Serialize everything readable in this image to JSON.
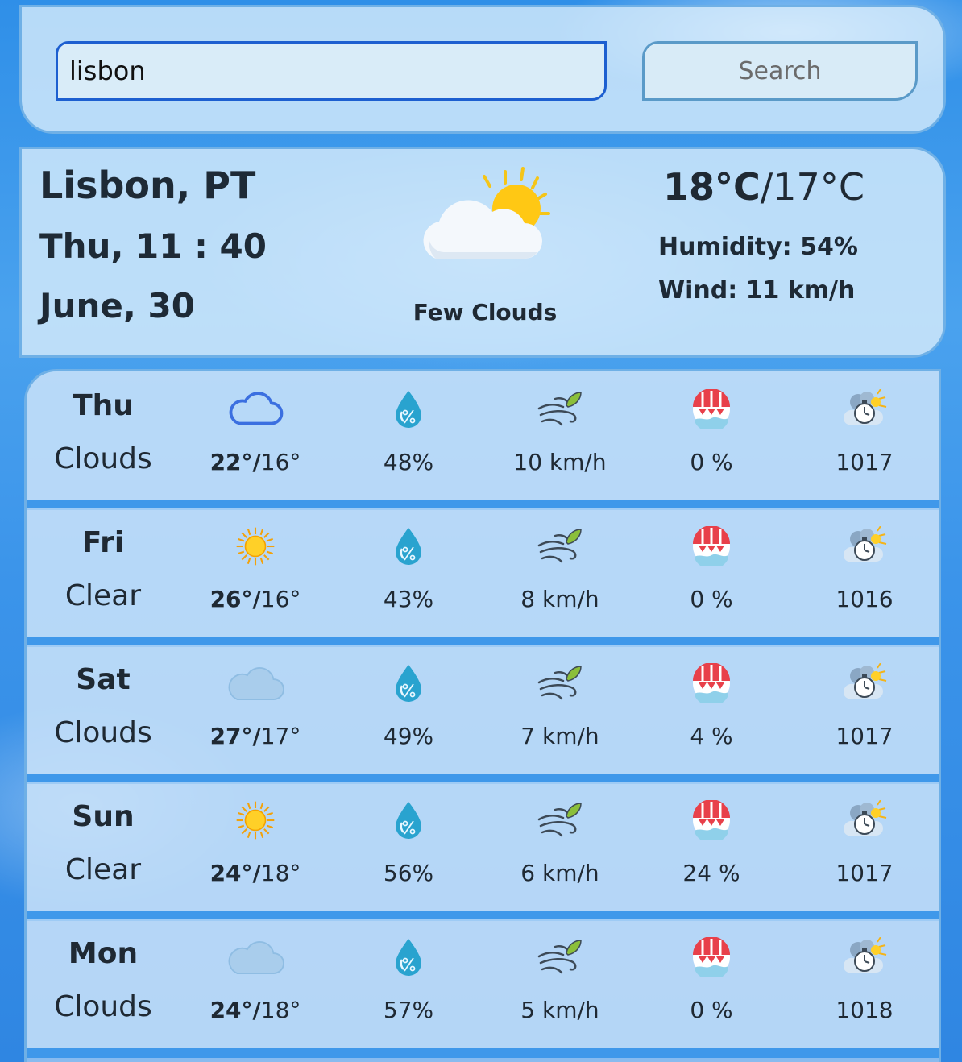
{
  "search": {
    "value": "lisbon",
    "button_label": "Search"
  },
  "current": {
    "city": "Lisbon, PT",
    "time": "Thu, 11 : 40",
    "date": "June, 30",
    "description": "Few Clouds",
    "icon": "few-clouds-icon",
    "temp_high": "18°C",
    "separator": "/",
    "temp_low": "17°C",
    "humidity": "Humidity: 54%",
    "wind": "Wind: 11 km/h"
  },
  "forecast": [
    {
      "day": "Thu",
      "condition": "Clouds",
      "icon": "cloud-outline-icon",
      "high": "22°",
      "sep": "/",
      "low": "16°",
      "humidity": "48%",
      "wind": "10 km/h",
      "precip": "0 %",
      "pressure": "1017"
    },
    {
      "day": "Fri",
      "condition": "Clear",
      "icon": "sun-icon",
      "high": "26°",
      "sep": "/",
      "low": "16°",
      "humidity": "43%",
      "wind": "8 km/h",
      "precip": "0 %",
      "pressure": "1016"
    },
    {
      "day": "Sat",
      "condition": "Clouds",
      "icon": "cloud-icon",
      "high": "27°",
      "sep": "/",
      "low": "17°",
      "humidity": "49%",
      "wind": "7 km/h",
      "precip": "4 %",
      "pressure": "1017"
    },
    {
      "day": "Sun",
      "condition": "Clear",
      "icon": "sun-icon",
      "high": "24°",
      "sep": "/",
      "low": "18°",
      "humidity": "56%",
      "wind": "6 km/h",
      "precip": "24 %",
      "pressure": "1017"
    },
    {
      "day": "Mon",
      "condition": "Clouds",
      "icon": "cloud-icon",
      "high": "24°",
      "sep": "/",
      "low": "18°",
      "humidity": "57%",
      "wind": "5 km/h",
      "precip": "0 %",
      "pressure": "1018"
    }
  ],
  "colors": {
    "accent_border": "#6fb0e6",
    "input_border": "#1d5fd0",
    "row_separator": "#3f98ea"
  }
}
